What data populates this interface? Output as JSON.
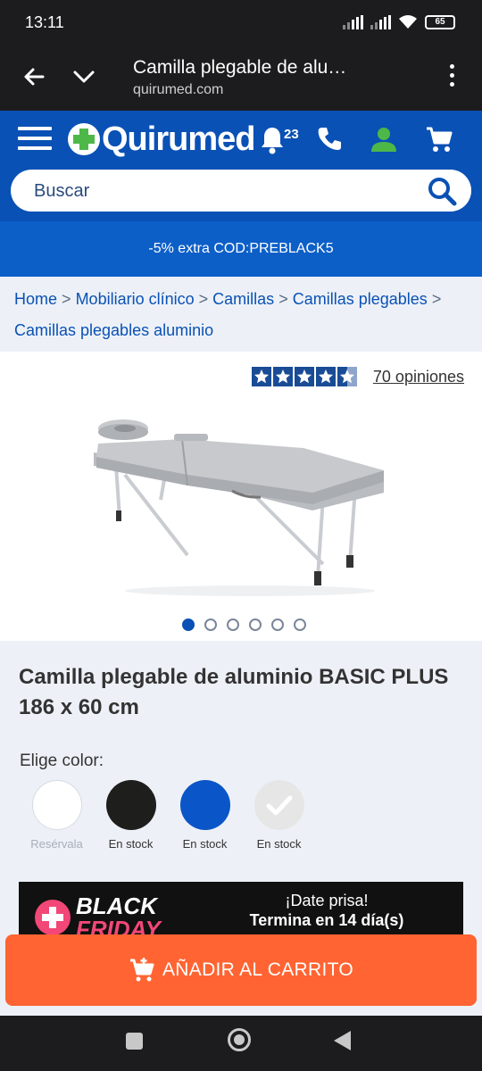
{
  "status_bar": {
    "time": "13:11",
    "battery": "65"
  },
  "browser": {
    "title": "Camilla plegable de alu…",
    "url": "quirumed.com"
  },
  "header": {
    "logo_text": "Quirumed",
    "notifications_count": "23",
    "search_placeholder": "Buscar",
    "brand_color": "#0a51b5",
    "accent_green": "#4db848"
  },
  "promo": {
    "text": "-5% extra COD:PREBLACK5"
  },
  "breadcrumb": {
    "items": [
      "Home",
      "Mobiliario clínico",
      "Camillas",
      "Camillas plegables",
      "Camillas plegables aluminio"
    ],
    "separator": ">"
  },
  "gallery": {
    "reviews_text": "70 opiniones",
    "rating": 4.5,
    "image_count": 6,
    "active_index": 0
  },
  "product": {
    "title": "Camilla plegable de aluminio BASIC PLUS 186 x 60 cm",
    "color_label": "Elige color:",
    "colors": [
      {
        "hex": "#ffffff",
        "caption": "Resérvala",
        "muted": true
      },
      {
        "hex": "#1e1e1c",
        "caption": "En stock",
        "muted": false
      },
      {
        "hex": "#0a55c8",
        "caption": "En stock",
        "muted": false
      },
      {
        "hex": "#e6e6e6",
        "caption": "En stock",
        "muted": false,
        "selected": true
      }
    ]
  },
  "black_friday": {
    "logo_line1": "BLACK",
    "logo_line2": "FRIDAY",
    "message_line1": "¡Date prisa!",
    "message_line2": "Termina en 14 día(s)"
  },
  "cart_button": {
    "label": "AÑADIR AL CARRITO",
    "color": "#ff6432"
  }
}
